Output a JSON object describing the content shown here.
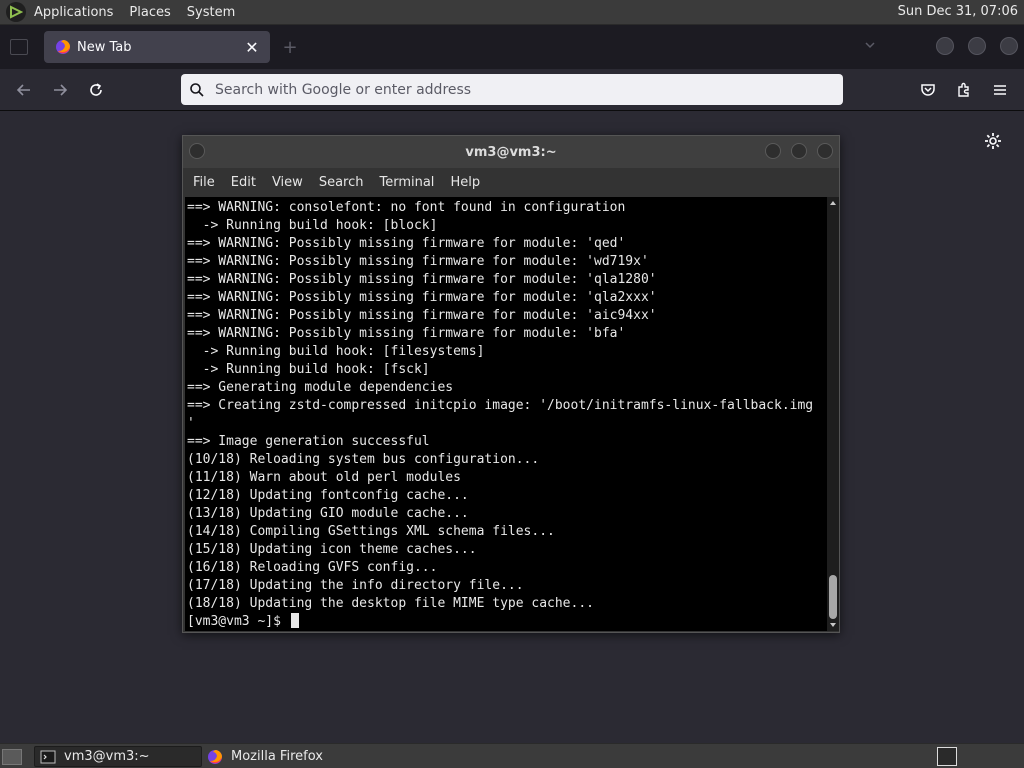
{
  "top_panel": {
    "menus": [
      "Applications",
      "Places",
      "System"
    ],
    "clock": "Sun Dec 31, 07:06"
  },
  "firefox": {
    "tab": {
      "title": "New Tab",
      "close_glyph": "✕"
    },
    "new_tab_glyph": "+",
    "urlbar": {
      "placeholder": "Search with Google or enter address"
    }
  },
  "terminal": {
    "title": "vm3@vm3:~",
    "menus": [
      "File",
      "Edit",
      "View",
      "Search",
      "Terminal",
      "Help"
    ],
    "lines": [
      "==> WARNING: consolefont: no font found in configuration",
      "  -> Running build hook: [block]",
      "==> WARNING: Possibly missing firmware for module: 'qed'",
      "==> WARNING: Possibly missing firmware for module: 'wd719x'",
      "==> WARNING: Possibly missing firmware for module: 'qla1280'",
      "==> WARNING: Possibly missing firmware for module: 'qla2xxx'",
      "==> WARNING: Possibly missing firmware for module: 'aic94xx'",
      "==> WARNING: Possibly missing firmware for module: 'bfa'",
      "  -> Running build hook: [filesystems]",
      "  -> Running build hook: [fsck]",
      "==> Generating module dependencies",
      "==> Creating zstd-compressed initcpio image: '/boot/initramfs-linux-fallback.img",
      "'",
      "==> Image generation successful",
      "(10/18) Reloading system bus configuration...",
      "(11/18) Warn about old perl modules",
      "(12/18) Updating fontconfig cache...",
      "(13/18) Updating GIO module cache...",
      "(14/18) Compiling GSettings XML schema files...",
      "(15/18) Updating icon theme caches...",
      "(16/18) Reloading GVFS config...",
      "(17/18) Updating the info directory file...",
      "(18/18) Updating the desktop file MIME type cache..."
    ],
    "prompt": "[vm3@vm3 ~]$ "
  },
  "taskbar": {
    "items": [
      {
        "label": "vm3@vm3:~",
        "icon": "terminal-icon",
        "active": true
      },
      {
        "label": "Mozilla Firefox",
        "icon": "firefox-icon",
        "active": false
      }
    ]
  },
  "colors": {
    "panel_bg": "#3b3b3b",
    "firefox_bg": "#2b2a33",
    "terminal_bg": "#000000",
    "terminal_fg": "#e8e8e8",
    "urlbar_bg": "#f0f0f4"
  }
}
